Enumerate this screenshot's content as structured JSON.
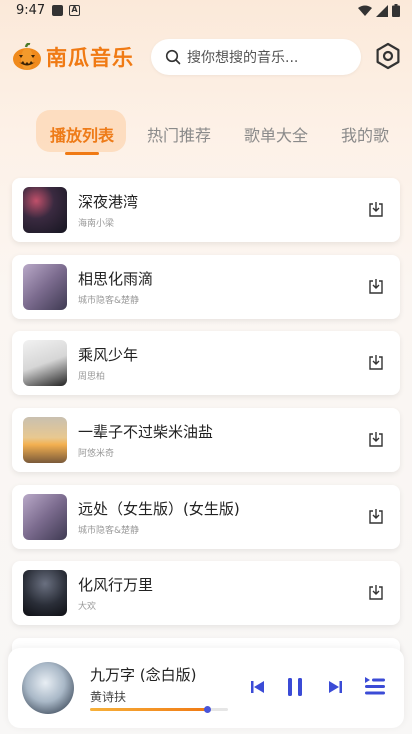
{
  "status_bar": {
    "time": "9:47",
    "a_icon": "A"
  },
  "header": {
    "app_name": "南瓜音乐",
    "search_placeholder": "搜你想搜的音乐...",
    "icons": [
      "pumpkin-logo-icon",
      "search-icon",
      "settings-icon"
    ]
  },
  "tabs": [
    {
      "label": "播放列表",
      "active": true
    },
    {
      "label": "热门推荐",
      "active": false
    },
    {
      "label": "歌单大全",
      "active": false
    },
    {
      "label": "我的歌",
      "active": false
    }
  ],
  "songs": [
    {
      "title": "深夜港湾",
      "artist": "海南小梁"
    },
    {
      "title": "相思化雨滴",
      "artist": "城市隐客&楚静"
    },
    {
      "title": "乘风少年",
      "artist": "周思柏"
    },
    {
      "title": "一辈子不过柴米油盐",
      "artist": "阿悠米奇"
    },
    {
      "title": "远处（女生版）(女生版)",
      "artist": "城市隐客&楚静"
    },
    {
      "title": "化风行万里",
      "artist": "大欢"
    }
  ],
  "player": {
    "title": "九万字 (念白版)",
    "artist": "黄诗扶",
    "progress": 0.85,
    "accent": "#f07a14",
    "controls": [
      "previous-icon",
      "pause-icon",
      "next-icon",
      "playlist-icon"
    ]
  }
}
